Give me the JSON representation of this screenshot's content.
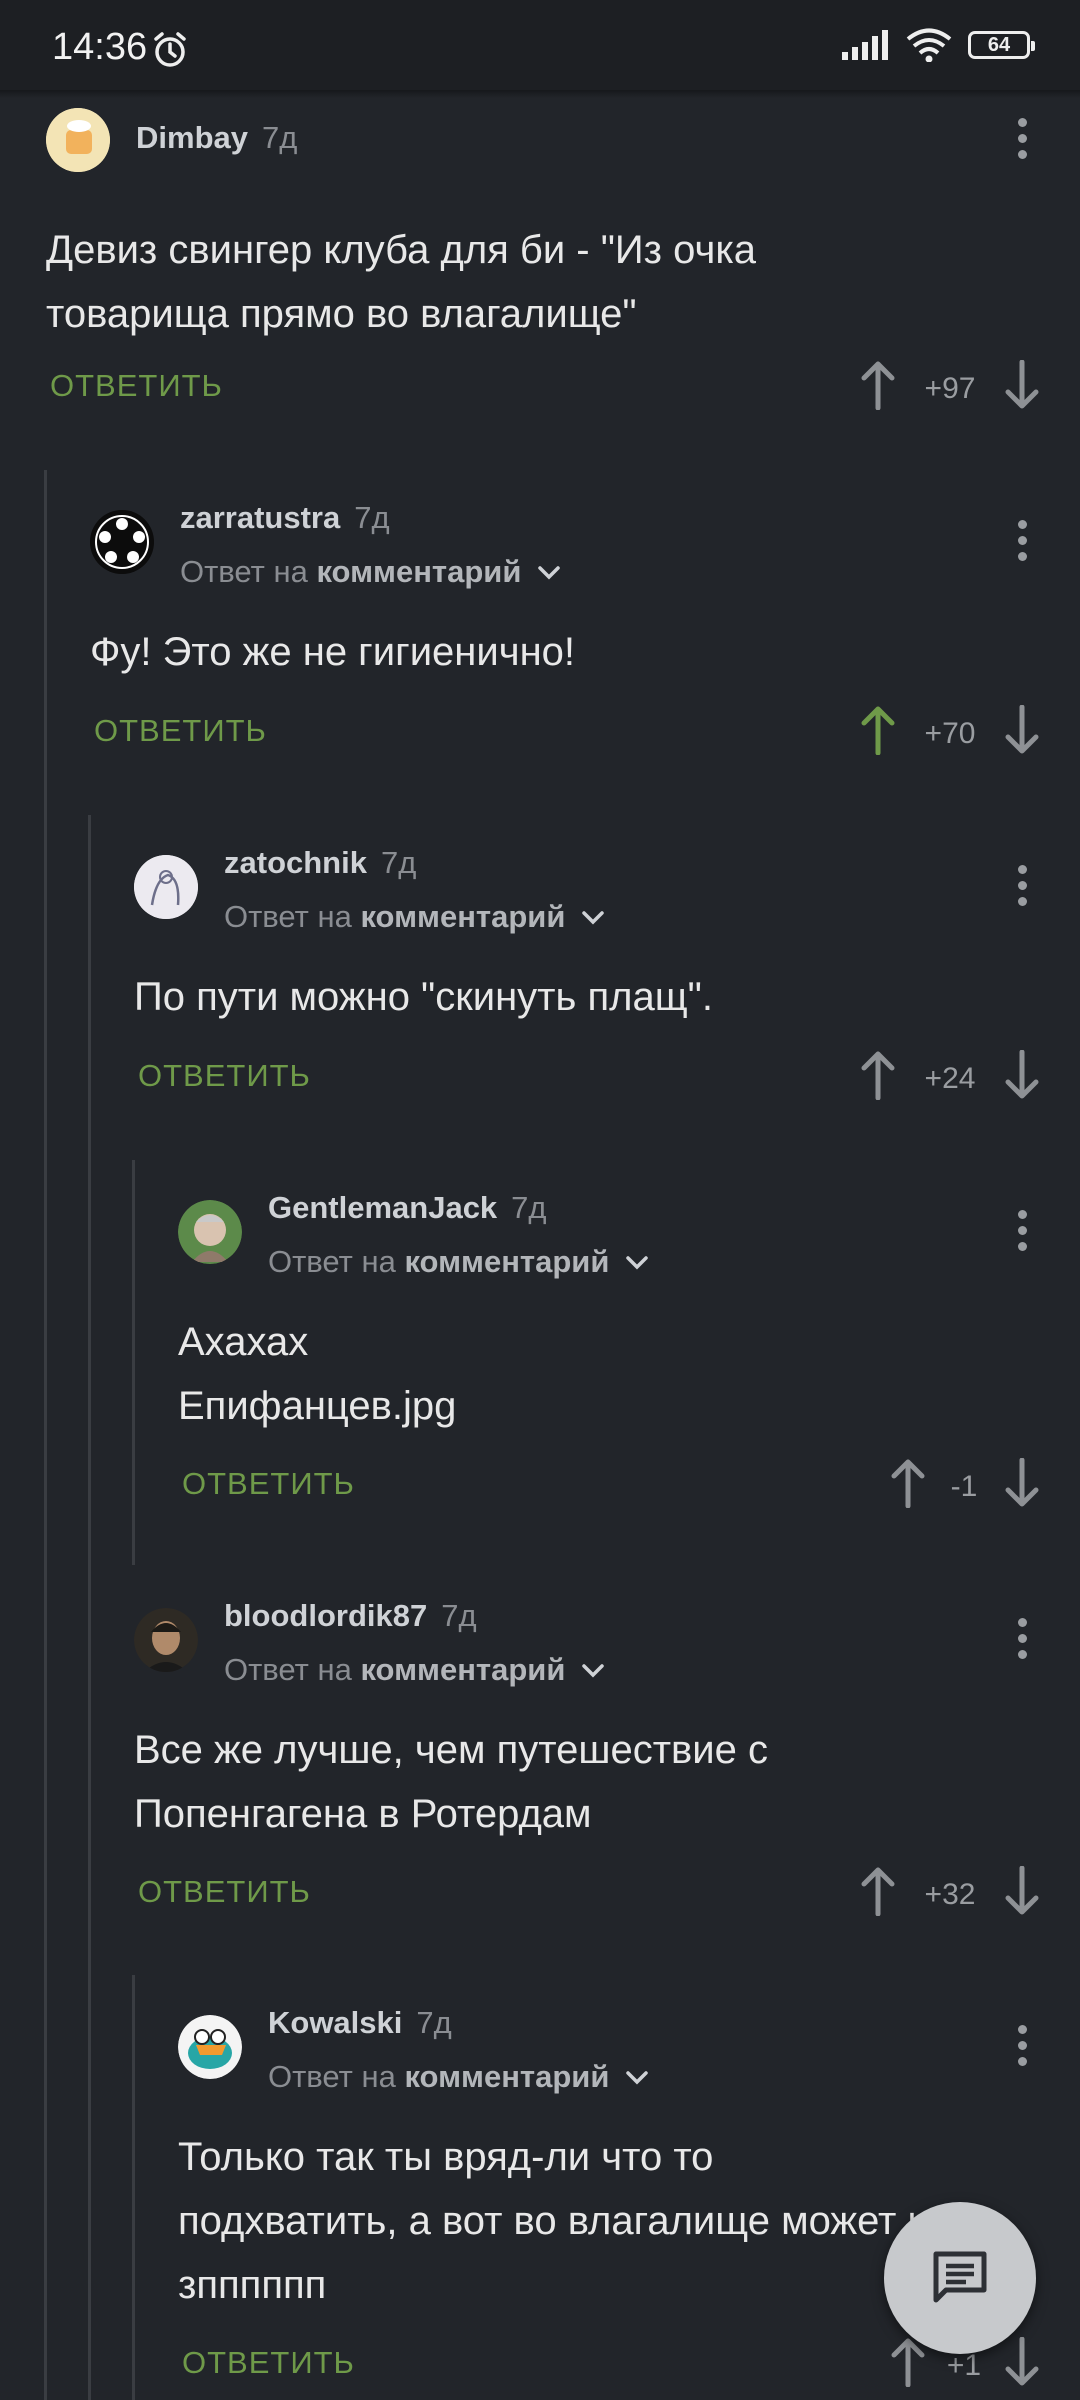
{
  "status": {
    "time": "14:36",
    "battery": "64"
  },
  "comments": [
    {
      "user": "Dimbay",
      "age": "7д",
      "reply_prefix": "",
      "reply_target": "",
      "text": "Девиз свингер клуба для би - \"Из очка\nтоварища прямо во влагалище\"",
      "reply": "ОТВЕТИТЬ",
      "score": "+97",
      "upvoted": false
    },
    {
      "user": "zarratustra",
      "age": "7д",
      "reply_prefix": "Ответ на",
      "reply_target": "комментарий",
      "text": "Фу! Это же не гигиенично!",
      "reply": "ОТВЕТИТЬ",
      "score": "+70",
      "upvoted": true
    },
    {
      "user": "zatochnik",
      "age": "7д",
      "reply_prefix": "Ответ на",
      "reply_target": "комментарий",
      "text": "По пути можно \"скинуть плащ\".",
      "reply": "ОТВЕТИТЬ",
      "score": "+24",
      "upvoted": false
    },
    {
      "user": "GentlemanJack",
      "age": "7д",
      "reply_prefix": "Ответ на",
      "reply_target": "комментарий",
      "text": "Ахахах\nЕпифанцев.jpg",
      "reply": "ОТВЕТИТЬ",
      "score": "-1",
      "upvoted": false
    },
    {
      "user": "bloodlordik87",
      "age": "7д",
      "reply_prefix": "Ответ на",
      "reply_target": "комментарий",
      "text": "Все же лучше, чем путешествие с\nПопенгагена в Ротердам",
      "reply": "ОТВЕТИТЬ",
      "score": "+32",
      "upvoted": false
    },
    {
      "user": "Kowalski",
      "age": "7д",
      "reply_prefix": "Ответ на",
      "reply_target": "комментарий",
      "text": "Только так ты вряд-ли что то\nподхватить, а вот во влагалище может и\nзпппппп",
      "reply": "ОТВЕТИТЬ",
      "score": "+1",
      "upvoted": false
    }
  ],
  "colors": {
    "accent": "#6f9a49",
    "background": "#22252a",
    "upvote_active": "#6f9a49"
  }
}
